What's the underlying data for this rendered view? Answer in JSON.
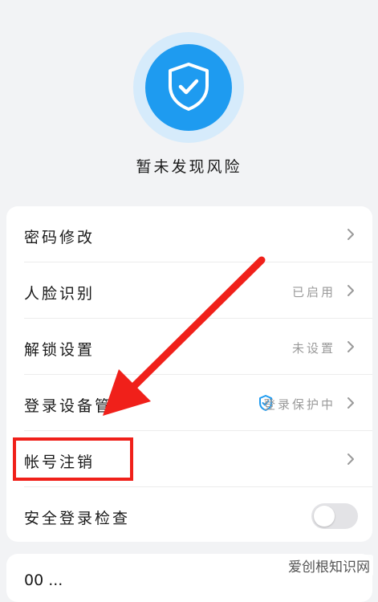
{
  "hero": {
    "status": "暂未发现风险",
    "icon": "shield-check-icon",
    "accent": "#1e9bf0"
  },
  "settings": {
    "rows": [
      {
        "label": "密码修改",
        "value": ""
      },
      {
        "label": "人脸识别",
        "value": "已启用"
      },
      {
        "label": "解锁设置",
        "value": "未设置"
      },
      {
        "label": "登录设备管",
        "value": "登录保护中"
      },
      {
        "label": "帐号注销",
        "value": ""
      },
      {
        "label": "安全登录检查",
        "value": ""
      }
    ],
    "toggle_state": "off"
  },
  "annotation": {
    "color": "#f0201a",
    "highlighted_row": "帐号注销"
  },
  "next_card": {
    "label": "00 ..."
  },
  "watermark": {
    "text": "爱创根知识网"
  }
}
